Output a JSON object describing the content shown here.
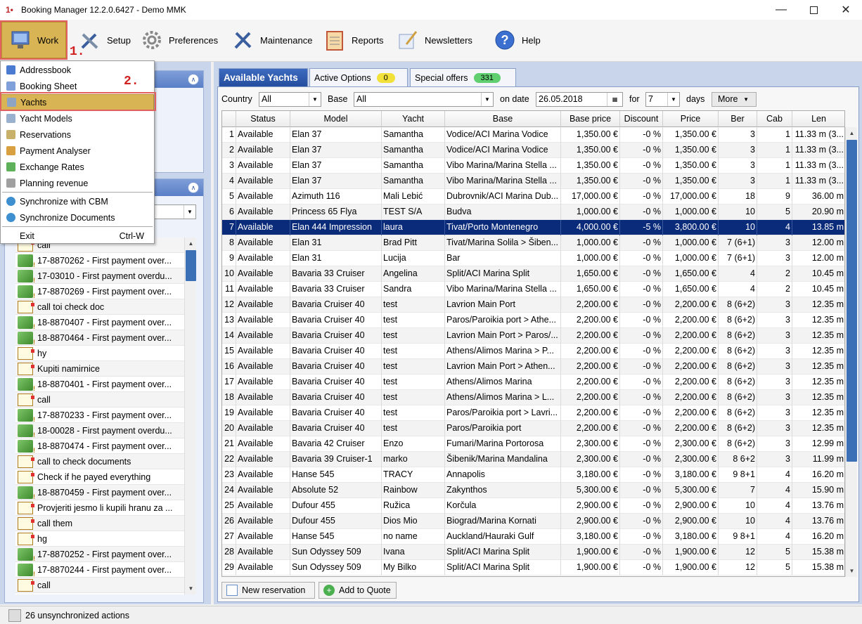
{
  "window": {
    "title": "Booking Manager 12.2.0.6427 - Demo MMK"
  },
  "toolbar": {
    "work": "Work",
    "setup": "Setup",
    "preferences": "Preferences",
    "maintenance": "Maintenance",
    "reports": "Reports",
    "newsletters": "Newsletters",
    "help": "Help"
  },
  "annotations": {
    "step1": "1.",
    "step2": "2."
  },
  "menu": {
    "items": [
      {
        "label": "Addressbook",
        "icon": "addressbook-icon"
      },
      {
        "label": "Booking Sheet",
        "icon": "booking-sheet-icon"
      },
      {
        "label": "Yachts",
        "icon": "yacht-icon"
      },
      {
        "label": "Yacht Models",
        "icon": "yacht-model-icon"
      },
      {
        "label": "Reservations",
        "icon": "reservations-icon"
      },
      {
        "label": "Payment Analyser",
        "icon": "payment-analyser-icon"
      },
      {
        "label": "Exchange Rates",
        "icon": "exchange-rates-icon"
      },
      {
        "label": "Planning revenue",
        "icon": "planning-revenue-icon"
      },
      {
        "label": "Synchronize with CBM",
        "icon": "sync-icon"
      },
      {
        "label": "Synchronize Documents",
        "icon": "sync-icon"
      },
      {
        "label": "Exit",
        "icon": ""
      }
    ],
    "exit_shortcut": "Ctrl-W"
  },
  "actions": [
    {
      "text": "call",
      "icon": "doc"
    },
    {
      "text": "17-8870262 - First payment over...",
      "icon": "money"
    },
    {
      "text": "17-03010 - First payment overdu...",
      "icon": "money"
    },
    {
      "text": "17-8870269 - First payment over...",
      "icon": "money"
    },
    {
      "text": "call toi check doc",
      "icon": "doc"
    },
    {
      "text": "18-8870407 - First payment over...",
      "icon": "money"
    },
    {
      "text": "18-8870464 - First payment over...",
      "icon": "money"
    },
    {
      "text": "hy",
      "icon": "doc"
    },
    {
      "text": "Kupiti namirnice",
      "icon": "doc"
    },
    {
      "text": "18-8870401 - First payment over...",
      "icon": "money"
    },
    {
      "text": "call",
      "icon": "doc"
    },
    {
      "text": "17-8870233 - First payment over...",
      "icon": "money"
    },
    {
      "text": "18-00028 - First payment overdu...",
      "icon": "money"
    },
    {
      "text": "18-8870474 - First payment over...",
      "icon": "money"
    },
    {
      "text": "call to check documents",
      "icon": "doc"
    },
    {
      "text": "Check if he payed everything",
      "icon": "doc"
    },
    {
      "text": "18-8870459 - First payment over...",
      "icon": "money"
    },
    {
      "text": "Provjeriti jesmo li kupili hranu za ...",
      "icon": "doc"
    },
    {
      "text": "call them",
      "icon": "doc"
    },
    {
      "text": "hg",
      "icon": "doc"
    },
    {
      "text": "17-8870252 - First payment over...",
      "icon": "money"
    },
    {
      "text": "17-8870244 - First payment over...",
      "icon": "money"
    },
    {
      "text": "call",
      "icon": "doc"
    }
  ],
  "tabs": [
    {
      "label": "Available Yachts"
    },
    {
      "label": "Active Options",
      "badge": "0",
      "badge_color": "#f2e13a"
    },
    {
      "label": "Special offers",
      "badge": "331",
      "badge_color": "#5fcf70"
    }
  ],
  "filters": {
    "country_label": "Country",
    "country_value": "All",
    "base_label": "Base",
    "base_value": "All",
    "date_label": "on date",
    "date_value": "26.05.2018",
    "for_label": "for",
    "for_value": "7",
    "days_label": "days",
    "more_label": "More"
  },
  "columns": [
    "",
    "Status",
    "Model",
    "Yacht",
    "Base",
    "Base price",
    "Discount",
    "Price",
    "Ber",
    "Cab",
    "Len"
  ],
  "rows": [
    [
      "1",
      "Available",
      "Elan 37",
      "Samantha",
      "Vodice/ACI Marina Vodice",
      "1,350.00 €",
      "-0 %",
      "1,350.00 €",
      "3",
      "1",
      "11.33 m (3..."
    ],
    [
      "2",
      "Available",
      "Elan 37",
      "Samantha",
      "Vodice/ACI Marina Vodice",
      "1,350.00 €",
      "-0 %",
      "1,350.00 €",
      "3",
      "1",
      "11.33 m (3..."
    ],
    [
      "3",
      "Available",
      "Elan 37",
      "Samantha",
      "Vibo Marina/Marina Stella ...",
      "1,350.00 €",
      "-0 %",
      "1,350.00 €",
      "3",
      "1",
      "11.33 m (3..."
    ],
    [
      "4",
      "Available",
      "Elan 37",
      "Samantha",
      "Vibo Marina/Marina Stella ...",
      "1,350.00 €",
      "-0 %",
      "1,350.00 €",
      "3",
      "1",
      "11.33 m (3..."
    ],
    [
      "5",
      "Available",
      "Azimuth 116",
      "Mali Lebić",
      "Dubrovnik/ACI Marina Dub...",
      "17,000.00 €",
      "-0 %",
      "17,000.00 €",
      "18",
      "9",
      "36.00 m"
    ],
    [
      "6",
      "Available",
      "Princess 65 Flya",
      "TEST S/A",
      "Budva",
      "1,000.00 €",
      "-0 %",
      "1,000.00 €",
      "10",
      "5",
      "20.90 m"
    ],
    [
      "7",
      "Available",
      "Elan 444 Impression",
      "laura",
      "Tivat/Porto Montenegro",
      "4,000.00 €",
      "-5 %",
      "3,800.00 €",
      "10",
      "4",
      "13.85 m"
    ],
    [
      "8",
      "Available",
      "Elan 31",
      "Brad Pitt",
      "Tivat/Marina Solila > Šiben...",
      "1,000.00 €",
      "-0 %",
      "1,000.00 €",
      "7 (6+1)",
      "3",
      "12.00 m"
    ],
    [
      "9",
      "Available",
      "Elan 31",
      "Lucija",
      "Bar",
      "1,000.00 €",
      "-0 %",
      "1,000.00 €",
      "7 (6+1)",
      "3",
      "12.00 m"
    ],
    [
      "10",
      "Available",
      "Bavaria 33 Cruiser",
      "Angelina",
      "Split/ACI Marina Split",
      "1,650.00 €",
      "-0 %",
      "1,650.00 €",
      "4",
      "2",
      "10.45 m"
    ],
    [
      "11",
      "Available",
      "Bavaria 33 Cruiser",
      "Sandra",
      "Vibo Marina/Marina Stella ...",
      "1,650.00 €",
      "-0 %",
      "1,650.00 €",
      "4",
      "2",
      "10.45 m"
    ],
    [
      "12",
      "Available",
      "Bavaria Cruiser 40",
      "test",
      "Lavrion Main Port",
      "2,200.00 €",
      "-0 %",
      "2,200.00 €",
      "8 (6+2)",
      "3",
      "12.35 m"
    ],
    [
      "13",
      "Available",
      "Bavaria Cruiser 40",
      "test",
      "Paros/Paroikia port > Athe...",
      "2,200.00 €",
      "-0 %",
      "2,200.00 €",
      "8 (6+2)",
      "3",
      "12.35 m"
    ],
    [
      "14",
      "Available",
      "Bavaria Cruiser 40",
      "test",
      "Lavrion Main Port > Paros/...",
      "2,200.00 €",
      "-0 %",
      "2,200.00 €",
      "8 (6+2)",
      "3",
      "12.35 m"
    ],
    [
      "15",
      "Available",
      "Bavaria Cruiser 40",
      "test",
      "Athens/Alimos Marina > P...",
      "2,200.00 €",
      "-0 %",
      "2,200.00 €",
      "8 (6+2)",
      "3",
      "12.35 m"
    ],
    [
      "16",
      "Available",
      "Bavaria Cruiser 40",
      "test",
      "Lavrion Main Port > Athen...",
      "2,200.00 €",
      "-0 %",
      "2,200.00 €",
      "8 (6+2)",
      "3",
      "12.35 m"
    ],
    [
      "17",
      "Available",
      "Bavaria Cruiser 40",
      "test",
      "Athens/Alimos Marina",
      "2,200.00 €",
      "-0 %",
      "2,200.00 €",
      "8 (6+2)",
      "3",
      "12.35 m"
    ],
    [
      "18",
      "Available",
      "Bavaria Cruiser 40",
      "test",
      "Athens/Alimos Marina > L...",
      "2,200.00 €",
      "-0 %",
      "2,200.00 €",
      "8 (6+2)",
      "3",
      "12.35 m"
    ],
    [
      "19",
      "Available",
      "Bavaria Cruiser 40",
      "test",
      "Paros/Paroikia port > Lavri...",
      "2,200.00 €",
      "-0 %",
      "2,200.00 €",
      "8 (6+2)",
      "3",
      "12.35 m"
    ],
    [
      "20",
      "Available",
      "Bavaria Cruiser 40",
      "test",
      "Paros/Paroikia port",
      "2,200.00 €",
      "-0 %",
      "2,200.00 €",
      "8 (6+2)",
      "3",
      "12.35 m"
    ],
    [
      "21",
      "Available",
      "Bavaria 42 Cruiser",
      "Enzo",
      "Fumari/Marina Portorosa",
      "2,300.00 €",
      "-0 %",
      "2,300.00 €",
      "8 (6+2)",
      "3",
      "12.99 m"
    ],
    [
      "22",
      "Available",
      "Bavaria 39 Cruiser-1",
      "marko",
      "Šibenik/Marina Mandalina",
      "2,300.00 €",
      "-0 %",
      "2,300.00 €",
      "8 6+2",
      "3",
      "11.99 m"
    ],
    [
      "23",
      "Available",
      "Hanse 545",
      "TRACY",
      "Annapolis",
      "3,180.00 €",
      "-0 %",
      "3,180.00 €",
      "9 8+1",
      "4",
      "16.20 m"
    ],
    [
      "24",
      "Available",
      "Absolute 52",
      "Rainbow",
      "Zakynthos",
      "5,300.00 €",
      "-0 %",
      "5,300.00 €",
      "7",
      "4",
      "15.90 m"
    ],
    [
      "25",
      "Available",
      "Dufour 455",
      "Ružica",
      "Korčula",
      "2,900.00 €",
      "-0 %",
      "2,900.00 €",
      "10",
      "4",
      "13.76 m"
    ],
    [
      "26",
      "Available",
      "Dufour 455",
      "Dios Mio",
      "Biograd/Marina Kornati",
      "2,900.00 €",
      "-0 %",
      "2,900.00 €",
      "10",
      "4",
      "13.76 m"
    ],
    [
      "27",
      "Available",
      "Hanse 545",
      "no name",
      "Auckland/Hauraki Gulf",
      "3,180.00 €",
      "-0 %",
      "3,180.00 €",
      "9 8+1",
      "4",
      "16.20 m"
    ],
    [
      "28",
      "Available",
      "Sun Odyssey 509",
      "Ivana",
      "Split/ACI Marina Split",
      "1,900.00 €",
      "-0 %",
      "1,900.00 €",
      "12",
      "5",
      "15.38 m"
    ],
    [
      "29",
      "Available",
      "Sun Odyssey 509",
      "My Bilko",
      "Split/ACI Marina Split",
      "1,900.00 €",
      "-0 %",
      "1,900.00 €",
      "12",
      "5",
      "15.38 m"
    ]
  ],
  "buttons": {
    "new_reservation": "New reservation",
    "add_to_quote": "Add to Quote"
  },
  "status": {
    "text": "26 unsynchronized actions"
  },
  "colors": {
    "accent": "#d9b454",
    "selection": "#0a2a7a",
    "tab_active": "#2d5aae"
  }
}
